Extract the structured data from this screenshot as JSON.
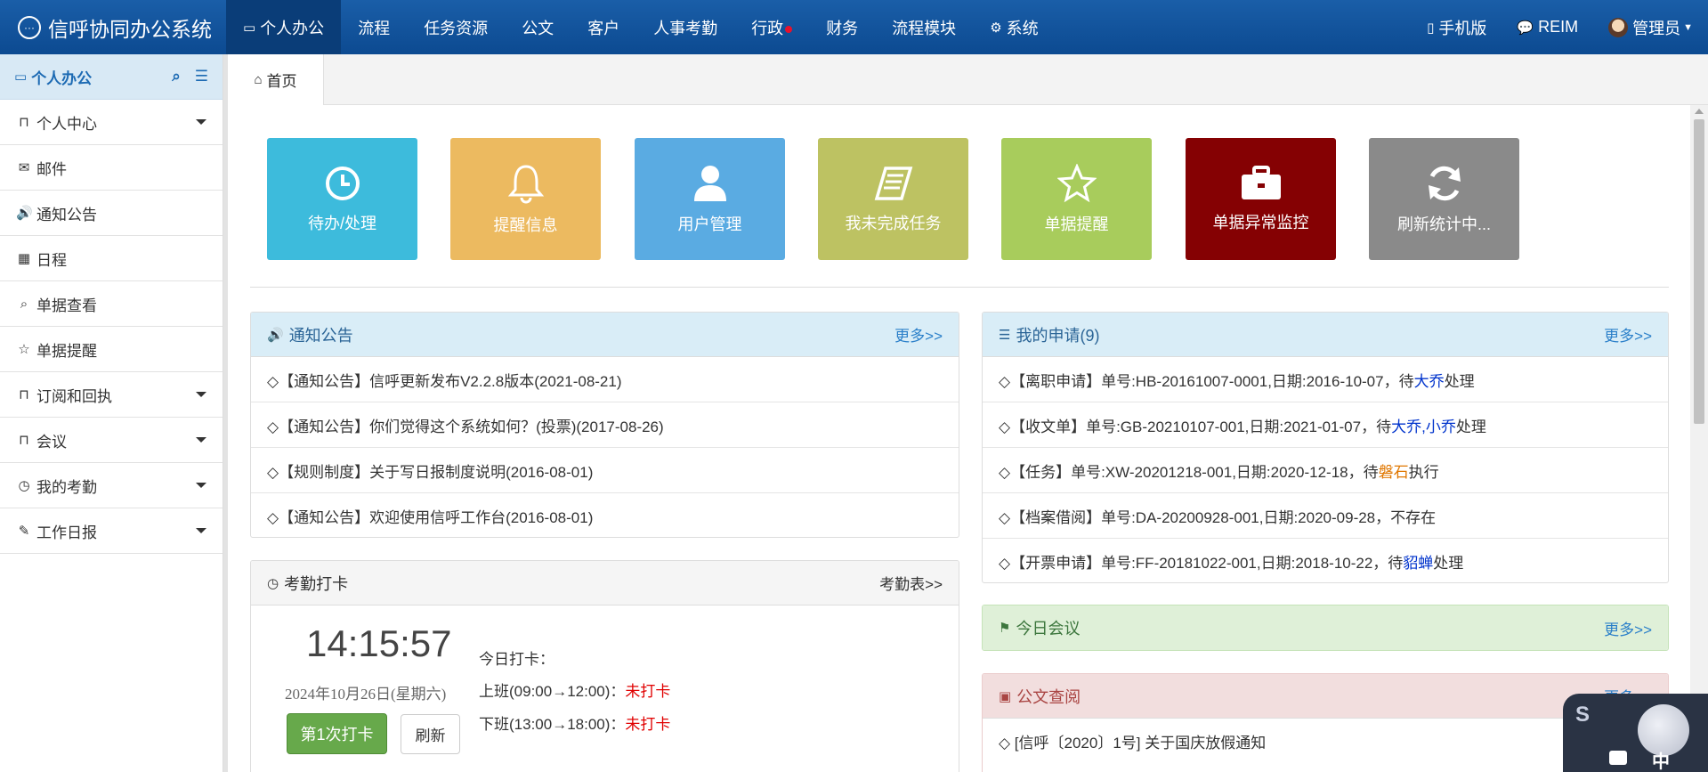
{
  "app": {
    "title": "信呼协同办公系统"
  },
  "topnav": {
    "items": [
      "个人办公",
      "流程",
      "任务资源",
      "公文",
      "客户",
      "人事考勤",
      "行政",
      "财务",
      "流程模块",
      "系统"
    ],
    "right": {
      "mobile": "手机版",
      "reim": "REIM",
      "user": "管理员"
    }
  },
  "sidebar": {
    "title": "个人办公",
    "items": [
      {
        "label": "个人中心",
        "icon": "bookmark-icon"
      },
      {
        "label": "邮件",
        "icon": "envelope-icon"
      },
      {
        "label": "通知公告",
        "icon": "volume-icon"
      },
      {
        "label": "日程",
        "icon": "calendar-icon"
      },
      {
        "label": "单据查看",
        "icon": "search-icon"
      },
      {
        "label": "单据提醒",
        "icon": "star-icon"
      },
      {
        "label": "订阅和回执",
        "icon": "bookmark-icon"
      },
      {
        "label": "会议",
        "icon": "bookmark-icon"
      },
      {
        "label": "我的考勤",
        "icon": "clock-icon"
      },
      {
        "label": "工作日报",
        "icon": "edit-icon"
      }
    ]
  },
  "tabs": {
    "home": "首页"
  },
  "tiles": [
    {
      "label": "待办/处理",
      "color": "#3dbbdc",
      "icon": "clock-icon"
    },
    {
      "label": "提醒信息",
      "color": "#ecba60",
      "icon": "bell-icon"
    },
    {
      "label": "用户管理",
      "color": "#5aabe2",
      "icon": "user-icon"
    },
    {
      "label": "我未完成任务",
      "color": "#bdc262",
      "icon": "book-icon"
    },
    {
      "label": "单据提醒",
      "color": "#a8cc5c",
      "icon": "star-icon"
    },
    {
      "label": "单据异常监控",
      "color": "#850103",
      "icon": "briefcase-icon"
    },
    {
      "label": "刷新统计中...",
      "color": "#8a8a8a",
      "icon": "refresh-icon"
    }
  ],
  "notice": {
    "title": "通知公告",
    "more": "更多>>",
    "rows": [
      "◇【通知公告】信呼更新发布V2.2.8版本(2021-08-21)",
      "◇【通知公告】你们觉得这个系统如何？(投票)(2017-08-26)",
      "◇【规则制度】关于写日报制度说明(2016-08-01)",
      "◇【通知公告】欢迎使用信呼工作台(2016-08-01)"
    ]
  },
  "apply": {
    "title": "我的申请(9)",
    "more": "更多>>",
    "rows": [
      {
        "text": "◇【离职申请】单号:HB-20161007-0001,日期:2016-10-07，待",
        "person": "大乔",
        "tail": "处理",
        "pcolor": "blue"
      },
      {
        "text": "◇【收文单】单号:GB-20210107-001,日期:2021-01-07，待",
        "person": "大乔,小乔",
        "tail": "处理",
        "pcolor": "blue"
      },
      {
        "text": "◇【任务】单号:XW-20201218-001,日期:2020-12-18，待",
        "person": "磐石",
        "tail": "执行",
        "pcolor": "orange"
      },
      {
        "text": "◇【档案借阅】单号:DA-20200928-001,日期:2020-09-28，不存在",
        "person": "",
        "tail": "",
        "pcolor": "blue"
      },
      {
        "text": "◇【开票申请】单号:FF-20181022-001,日期:2018-10-22，待",
        "person": "貂蝉",
        "tail": "处理",
        "pcolor": "blue"
      }
    ]
  },
  "attendance": {
    "title": "考勤打卡",
    "more": "考勤表>>",
    "time": "14:15:57",
    "date": "2024年10月26日(星期六)",
    "today": "今日打卡：",
    "shift1": "上班(09:00→12:00)：",
    "shift1_status": "未打卡",
    "shift2": "下班(13:00→18:00)：",
    "shift2_status": "未打卡",
    "punch_button": "第1次打卡",
    "refresh_button": "刷新"
  },
  "meeting": {
    "title": "今日会议",
    "more": "更多>>"
  },
  "doc": {
    "title": "公文查阅",
    "more": "更多>>",
    "rows": [
      "◇ [信呼〔2020〕1号] 关于国庆放假通知"
    ]
  },
  "widget": {
    "label": "中"
  }
}
